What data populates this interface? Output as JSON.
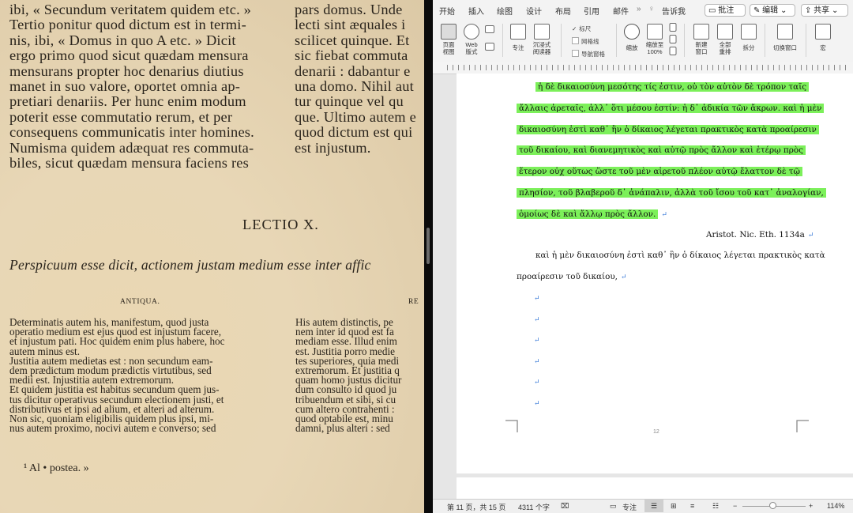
{
  "scan": {
    "top_lines": [
      {
        "left": "ibi, « Secundum veritatem quidem etc. »",
        "right": "pars domus. Unde"
      },
      {
        "left": "Tertio ponitur quod dictum est in termi-",
        "right": "lecti sint æquales i"
      },
      {
        "left": "nis, ibi, « Domus in quo A etc. » Dicit",
        "right": "scilicet quinque. Et"
      },
      {
        "left": "ergo primo quod sicut quædam mensura",
        "right": "sic fiebat commuta"
      },
      {
        "left": "mensurans propter hoc denarius diutius",
        "right": "denarii : dabantur e"
      },
      {
        "left": "manet in suo valore, oportet omnia ap-",
        "right": "una domo. Nihil aut"
      },
      {
        "left": "pretiari denariis. Per hunc enim modum",
        "right": "tur quinque vel qu"
      },
      {
        "left": "poterit esse commutatio rerum, et per",
        "right": "que. Ultimo autem e"
      },
      {
        "left": "consequens communicatis inter homines.",
        "right": "quod dictum est qui"
      },
      {
        "left": "Numisma quidem adæquat res commuta-",
        "right": "est injustum."
      },
      {
        "left": "biles, sicut quædam mensura faciens res",
        "right": ""
      }
    ],
    "lectio_heading": "LECTIO X.",
    "italic_summary": "Perspicuum esse dicit, actionem justam medium esse inter affic",
    "col_left_heading": "ANTIQUA.",
    "col_right_heading": "RE",
    "small_lines": [
      {
        "left": "Determinatis autem his, manifestum, quod justa",
        "right": "His autem distinctis, pe"
      },
      {
        "left": "operatio medium est ejus quod est injustum facere,",
        "right": "nem inter id quod est fa"
      },
      {
        "left": "et injustum pati. Hoc quidem enim plus habere, hoc",
        "right": "mediam esse. Illud enim"
      },
      {
        "left": "autem minus est.",
        "right": "est. Justitia porro medie"
      },
      {
        "left": "Justitia autem medietas est : non secundum eam-",
        "right": "tes superiores, quia medi"
      },
      {
        "left": "dem prædictum modum prædictis virtutibus, sed",
        "right": "extremorum. Et justitia q"
      },
      {
        "left": "medii est. Injustitia autem extremorum.",
        "right": "quam homo justus dicitur"
      },
      {
        "left": "Et quidem justitia est habitus secundum quem jus-",
        "right": "dum consulto id quod ju"
      },
      {
        "left": "tus dicitur operativus secundum electionem justi, et",
        "right": "tribuendum et sibi, si cu"
      },
      {
        "left": "distributivus et ipsi ad alium, et alteri ad alterum.",
        "right": "cum altero contrahenti :"
      },
      {
        "left": "Non sic, quoniam eligibilis quidem plus ipsi, mi-",
        "right": "quod optabile est, minu"
      },
      {
        "left": "nus autem proximo, nocivi autem e converso; sed",
        "right": "damni, plus alteri : sed"
      }
    ],
    "footnote": "¹ Al • postea. »"
  },
  "word": {
    "tabs": [
      "开始",
      "插入",
      "绘图",
      "设计",
      "布局",
      "引用",
      "邮件"
    ],
    "tell_me": "告诉我",
    "comment_button": "批注",
    "edit_button": "编辑",
    "share_button": "共享",
    "ribbon": {
      "page_view": "页面\n视图",
      "web_view": "Web\n版式",
      "focus": "专注",
      "immersive_reader": "沉浸式\n阅读器",
      "ruler": "标尺",
      "gridlines": "网格线",
      "nav_pane": "导航窗格",
      "zoom": "缩放",
      "zoom_100": "缩放至\n100%",
      "new_window": "新建\n窗口",
      "arrange_all": "全部\n重排",
      "split": "拆分",
      "switch_window": "切换窗口",
      "macros": "宏"
    },
    "highlighted_lines": [
      "ἡ δὲ δικαιοσύνη μεσότης τίς ἐστιν, οὐ τὸν αὐτὸν δὲ τρόπον ταῖς",
      "ἄλλαις ἀρεταῖς, ἀλλ᾽ ὅτι μέσου ἐστίν: ἡ δ᾽ ἀδικία τῶν ἄκρων. καὶ ἡ μὲν",
      "δικαιοσύνη ἐστὶ καθ᾽ ἣν ὁ δίκαιος λέγεται πρακτικὸς κατὰ προαίρεσιν",
      "τοῦ δικαίου, καὶ διανεμητικὸς καὶ αὑτῷ πρὸς ἄλλον καὶ ἑτέρῳ πρὸς",
      "ἕτερον οὐχ οὕτως ὥστε τοῦ μὲν αἱρετοῦ πλέον αὑτῷ ἔλαττον δὲ τῷ",
      "πλησίον, τοῦ βλαβεροῦ δ᾽ ἀνάπαλιν, ἀλλὰ τοῦ ἴσου τοῦ κατ᾽ ἀναλογίαν,",
      "ὁμοίως δὲ καὶ ἄλλῳ πρὸς ἄλλον."
    ],
    "citation": "Aristot. Nic. Eth. 1134a",
    "body_lines": [
      "καὶ ἡ μὲν δικαιοσύνη ἐστὶ καθ᾽ ἣν ὁ δίκαιος λέγεται πρακτικὸς κατὰ",
      "προαίρεσιν τοῦ δικαίου,"
    ],
    "paragraph_mark": "↵",
    "page_number": "12",
    "status": {
      "page": "第 11 页，共 15 页",
      "words": "4311 个字",
      "focus": "专注",
      "zoom": "114%"
    },
    "colors": {
      "highlight": "#7cf05a",
      "accent": "#2b5fb4"
    }
  }
}
